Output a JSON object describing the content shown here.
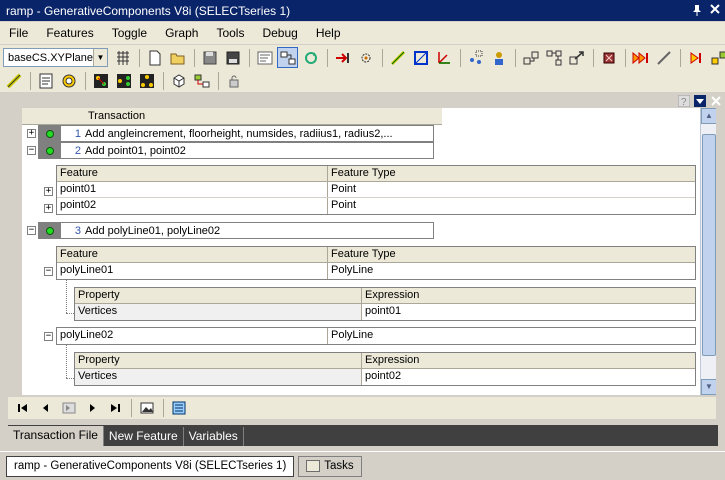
{
  "window": {
    "title": "ramp - GenerativeComponents V8i (SELECTseries 1)",
    "pin_glyph": "📌",
    "close_glyph": "✕"
  },
  "menu": [
    "File",
    "Features",
    "Toggle",
    "Graph",
    "Tools",
    "Debug",
    "Help"
  ],
  "toolbar": {
    "coordinate_system": "baseCS.XYPlane"
  },
  "transaction_file": {
    "header": "Transaction",
    "transactions": [
      {
        "number": "1",
        "text": "Add  angleincrement,  floorheight,  numsides,  radiius1,  radius2,...",
        "expanded": false
      },
      {
        "number": "2",
        "text": "Add point01, point02",
        "expanded": true
      },
      {
        "number": "3",
        "text": "Add polyLine01, polyLine02",
        "expanded": true
      }
    ],
    "t2_features": {
      "columns": [
        "Feature",
        "Feature Type"
      ],
      "rows": [
        [
          "point01",
          "Point"
        ],
        [
          "point02",
          "Point"
        ]
      ]
    },
    "t3_features": {
      "columns": [
        "Feature",
        "Feature Type"
      ],
      "rows": [
        [
          "polyLine01",
          "PolyLine"
        ],
        [
          "polyLine02",
          "PolyLine"
        ]
      ]
    },
    "polyline01_props": {
      "columns": [
        "Property",
        "Expression"
      ],
      "rows": [
        [
          "Vertices",
          "point01"
        ]
      ]
    },
    "polyline02_props": {
      "columns": [
        "Property",
        "Expression"
      ],
      "rows": [
        [
          "Vertices",
          "point02"
        ]
      ]
    }
  },
  "bottom_tabs": [
    "Transaction File",
    "New Feature",
    "Variables"
  ],
  "taskbar": {
    "items": [
      "ramp - GenerativeComponents V8i (SELECTseries 1)",
      "Tasks"
    ]
  },
  "colors": {
    "title_bar": "#0a246a",
    "tab_strip": "#404040",
    "led_green": "#22dd22"
  }
}
